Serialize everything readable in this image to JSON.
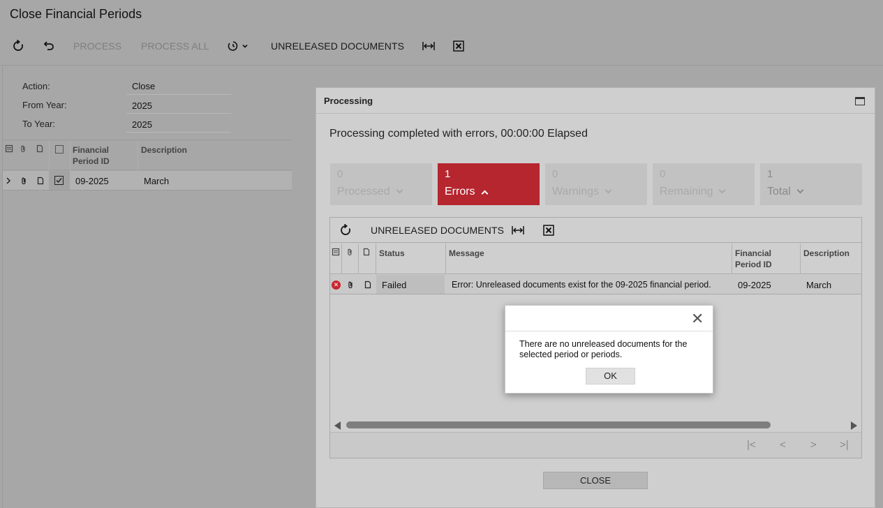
{
  "page": {
    "title": "Close Financial Periods",
    "toolbar": {
      "process": "PROCESS",
      "process_all": "PROCESS ALL",
      "unreleased_documents": "UNRELEASED DOCUMENTS"
    },
    "form": {
      "action_label": "Action:",
      "action_value": "Close",
      "from_year_label": "From Year:",
      "from_year_value": "2025",
      "to_year_label": "To Year:",
      "to_year_value": "2025"
    },
    "grid": {
      "columns": [
        "Financial Period ID",
        "Description"
      ],
      "rows": [
        {
          "period_id": "09-2025",
          "description": "March"
        }
      ]
    }
  },
  "processing": {
    "title": "Processing",
    "status_text": "Processing completed with errors, 00:00:00 Elapsed",
    "tiles": [
      {
        "count": "0",
        "label": "Processed"
      },
      {
        "count": "1",
        "label": "Errors"
      },
      {
        "count": "0",
        "label": "Warnings"
      },
      {
        "count": "0",
        "label": "Remaining"
      },
      {
        "count": "1",
        "label": "Total"
      }
    ],
    "grid_toolbar": {
      "unreleased_documents": "UNRELEASED DOCUMENTS"
    },
    "columns": {
      "status": "Status",
      "message": "Message",
      "period_id": "Financial Period ID",
      "description": "Description"
    },
    "rows": [
      {
        "status": "Failed",
        "message": "Error: Unreleased documents exist for the 09-2025 financial period.",
        "period_id": "09-2025",
        "description": "March"
      }
    ],
    "close_button": "CLOSE"
  },
  "message_box": {
    "text": "There are no unreleased documents for the selected period or periods.",
    "ok_button": "OK"
  },
  "colors": {
    "error_tile": "#b5262f",
    "overlay": "#a7a7a7"
  }
}
